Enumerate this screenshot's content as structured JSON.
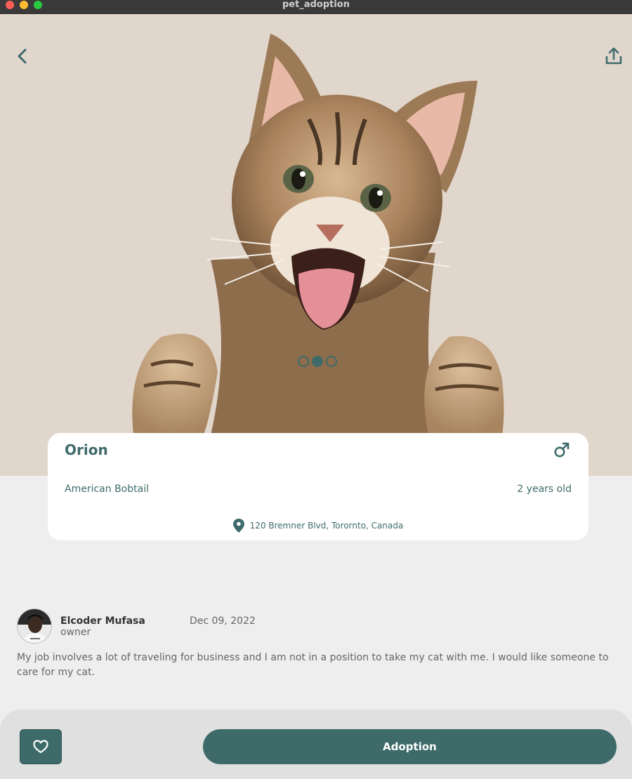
{
  "window": {
    "title": "pet_adoption"
  },
  "hero": {
    "back_icon": "chevron-left-icon",
    "share_icon": "share-upload-icon",
    "carousel": {
      "count": 3,
      "active_index": 1
    }
  },
  "pet": {
    "name": "Orion",
    "gender_icon": "male-icon",
    "breed": "American Bobtail",
    "age": "2 years old",
    "location_icon": "map-pin-icon",
    "location": "120 Bremner Blvd, Torornto, Canada"
  },
  "owner": {
    "name": "Elcoder Mufasa",
    "role": "owner",
    "date": "Dec 09, 2022",
    "description": "My job involves a lot of traveling for business and I am not in a position to take my cat with me. I would like someone to care for my cat."
  },
  "actions": {
    "favorite_icon": "heart-icon",
    "adopt_label": "Adoption"
  },
  "colors": {
    "accent": "#3e6b6a",
    "hero_background": "#e1d6cc",
    "page_background": "#efeeee",
    "card_background": "#ffffff"
  }
}
